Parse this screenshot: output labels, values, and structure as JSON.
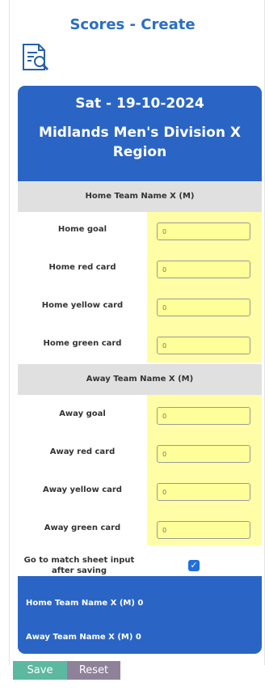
{
  "page": {
    "title": "Scores - Create",
    "icon": "document-search-icon"
  },
  "match": {
    "date": "Sat - 19-10-2024",
    "competition": "Midlands Men's Division X Region"
  },
  "home": {
    "team_label": "Home Team Name X (M)",
    "fields": [
      {
        "label": "Home goal",
        "placeholder": "0"
      },
      {
        "label": "Home red card",
        "placeholder": "0"
      },
      {
        "label": "Home yellow card",
        "placeholder": "0"
      },
      {
        "label": "Home green card",
        "placeholder": "0"
      }
    ]
  },
  "away": {
    "team_label": "Away Team Name X (M)",
    "fields": [
      {
        "label": "Away goal",
        "placeholder": "0"
      },
      {
        "label": "Away red card",
        "placeholder": "0"
      },
      {
        "label": "Away yellow card",
        "placeholder": "0"
      },
      {
        "label": "Away green card",
        "placeholder": "0"
      }
    ]
  },
  "options": {
    "match_sheet_label": "Go to match sheet input after saving",
    "match_sheet_checked": true
  },
  "summary": {
    "home": "Home Team Name X (M) 0",
    "away": "Away Team Name X (M) 0"
  },
  "buttons": {
    "save": "Save",
    "reset": "Reset"
  },
  "colors": {
    "header_blue": "#2a65c5",
    "title_blue": "#2a6fc4",
    "highlight_yellow": "#fffea6",
    "save_green": "#5cb8a0",
    "reset_purple": "#8e8199"
  }
}
